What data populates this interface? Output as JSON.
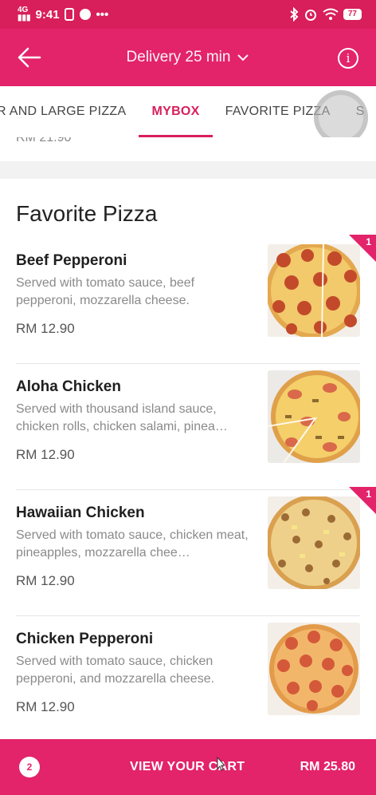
{
  "status_bar": {
    "network": "4G",
    "time": "9:41",
    "dots": "•••",
    "battery": "77"
  },
  "header": {
    "title": "Delivery 25 min"
  },
  "tabs": [
    {
      "label": "R AND LARGE PIZZA",
      "active": false
    },
    {
      "label": "MYBOX",
      "active": true
    },
    {
      "label": "FAVORITE PIZZA",
      "active": false
    },
    {
      "label": "S",
      "active": false
    }
  ],
  "previous_section": {
    "price_fragment": "RM 21.90"
  },
  "section": {
    "title": "Favorite Pizza",
    "items": [
      {
        "name": "Beef Pepperoni",
        "description": "Served with tomato sauce, beef pepperoni, mozzarella cheese.",
        "price": "RM 12.90",
        "badge": "1"
      },
      {
        "name": "Aloha Chicken",
        "description": "Served with thousand island sauce, chicken rolls, chicken salami, pinea…",
        "price": "RM 12.90",
        "badge": null
      },
      {
        "name": "Hawaiian Chicken",
        "description": "Served with tomato sauce, chicken meat, pineapples, mozzarella chee…",
        "price": "RM 12.90",
        "badge": "1"
      },
      {
        "name": "Chicken Pepperoni",
        "description": "Served with tomato sauce, chicken pepperoni, and mozzarella cheese.",
        "price": "RM 12.90",
        "badge": null
      }
    ]
  },
  "cart": {
    "count": "2",
    "label": "VIEW YOUR CART",
    "total": "RM 25.80"
  },
  "colors": {
    "brand": "#e3236a",
    "status_bar": "#d81e5b"
  },
  "icons": [
    "back-arrow-icon",
    "chevron-down-icon",
    "info-icon",
    "bluetooth-icon",
    "alarm-icon",
    "wifi-icon",
    "battery-icon",
    "signal-icon",
    "sim-icon",
    "chat-icon"
  ]
}
